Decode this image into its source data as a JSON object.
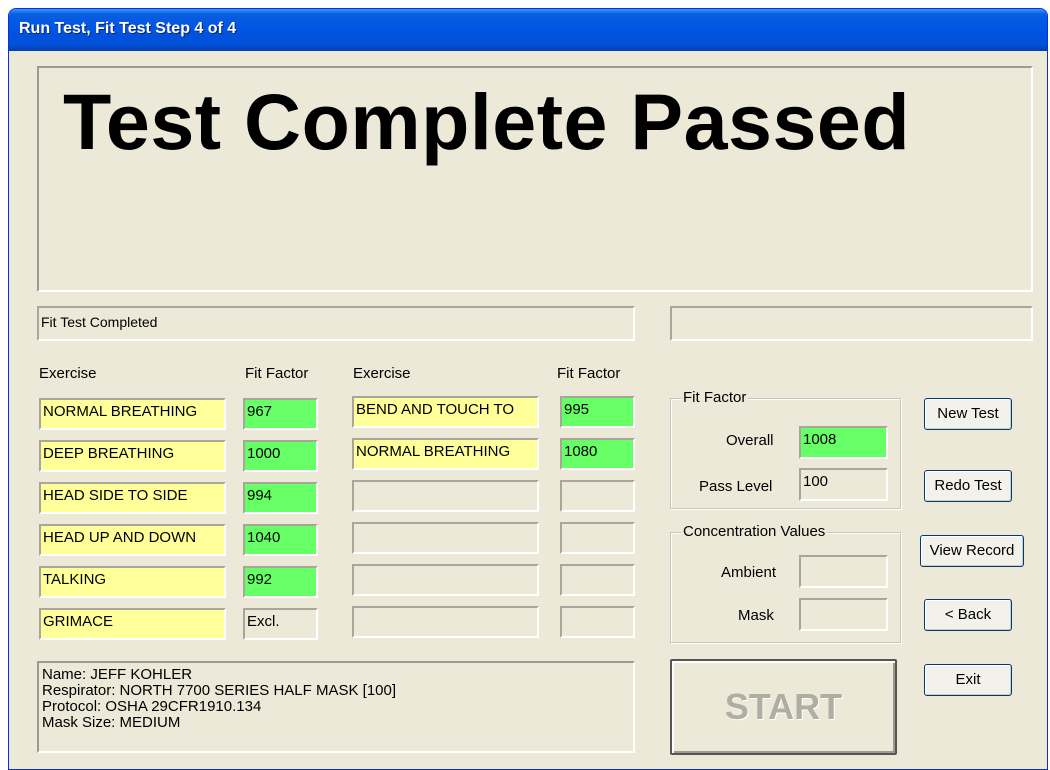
{
  "window": {
    "title": "Run Test, Fit Test Step 4 of 4"
  },
  "banner": {
    "text": "Test Complete Passed"
  },
  "status": {
    "message": "Fit Test Completed",
    "secondary": ""
  },
  "table": {
    "headers": {
      "exercise": "Exercise",
      "fit_factor": "Fit Factor"
    },
    "left": [
      {
        "exercise": "NORMAL BREATHING",
        "fit": "967"
      },
      {
        "exercise": "DEEP BREATHING",
        "fit": "1000"
      },
      {
        "exercise": "HEAD SIDE TO SIDE",
        "fit": "994"
      },
      {
        "exercise": "HEAD UP AND DOWN",
        "fit": "1040"
      },
      {
        "exercise": "TALKING",
        "fit": "992"
      },
      {
        "exercise": "GRIMACE",
        "fit": "Excl."
      }
    ],
    "right": [
      {
        "exercise": "BEND AND TOUCH TO",
        "fit": "995"
      },
      {
        "exercise": "NORMAL BREATHING",
        "fit": "1080"
      },
      {
        "exercise": "",
        "fit": ""
      },
      {
        "exercise": "",
        "fit": ""
      },
      {
        "exercise": "",
        "fit": ""
      },
      {
        "exercise": "",
        "fit": ""
      }
    ]
  },
  "fit_factor_group": {
    "title": "Fit Factor",
    "overall_label": "Overall",
    "overall_value": "1008",
    "pass_level_label": "Pass Level",
    "pass_level_value": "100"
  },
  "concentration_group": {
    "title": "Concentration Values",
    "ambient_label": "Ambient",
    "ambient_value": "",
    "mask_label": "Mask",
    "mask_value": ""
  },
  "info": {
    "name": "Name: JEFF KOHLER",
    "respirator": "Respirator: NORTH 7700 SERIES HALF MASK [100]",
    "protocol": "Protocol: OSHA 29CFR1910.134",
    "mask_size": "Mask Size: MEDIUM"
  },
  "buttons": {
    "new_test": "New Test",
    "redo_test": "Redo Test",
    "view_record": "View Record",
    "back": "< Back",
    "exit": "Exit",
    "start": "START"
  },
  "colors": {
    "exercise_field": "#ffff99",
    "fit_pass_field": "#66ff66",
    "title_bar": "#0054e3",
    "dialog_bg": "#ece9d8"
  }
}
